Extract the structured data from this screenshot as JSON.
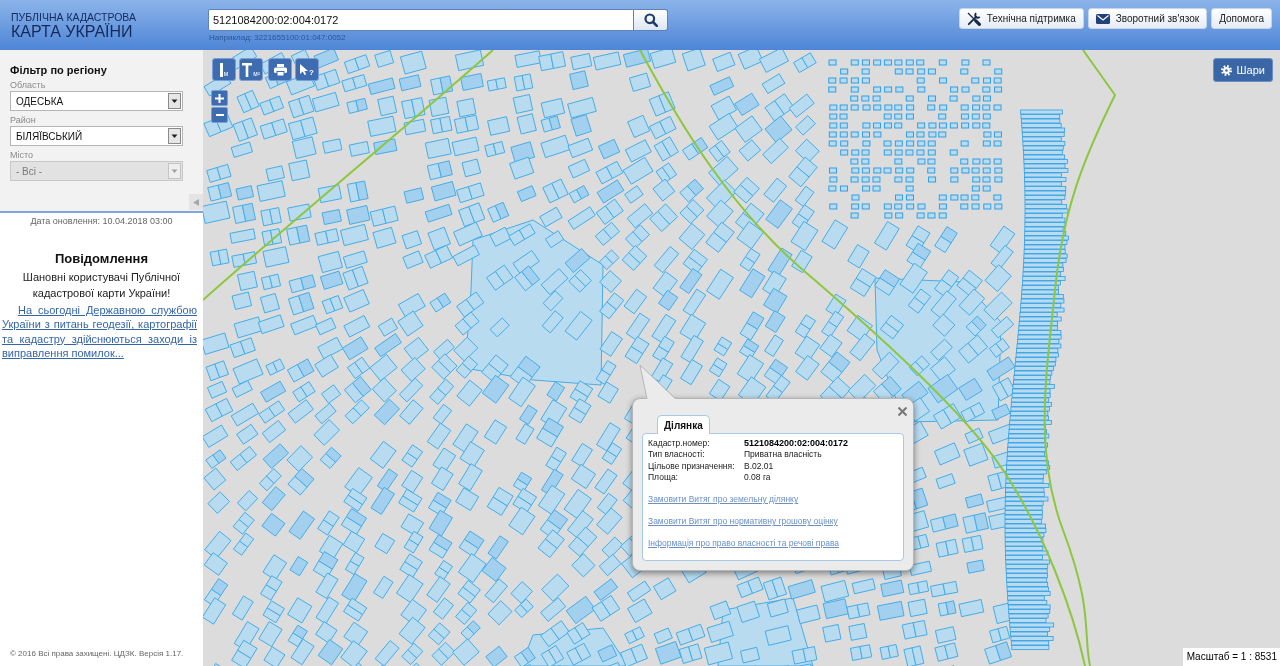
{
  "header": {
    "logo": {
      "line_1": "ПУБЛІЧНА КАДАСТРОВА",
      "line_2": "КАРТА УКРАЇНИ"
    },
    "search": {
      "value": "5121084200:02:004:0172",
      "example": "Наприклад: 3221655100:01:047:0052"
    },
    "buttons": [
      {
        "kind": "support",
        "label": "Технічна підтримка"
      },
      {
        "kind": "feedback",
        "label": "Зворотний зв'язок"
      },
      {
        "kind": "help",
        "label": "Допомога"
      }
    ]
  },
  "sidebar": {
    "filter": {
      "title": "Фільтр по регіону",
      "fields": [
        {
          "label": "Область",
          "value": "ОДЕСЬКА",
          "disabled": false
        },
        {
          "label": "Район",
          "value": "БІЛЯЇВСЬКИЙ",
          "disabled": false
        },
        {
          "label": "Місто",
          "value": "- Всі -",
          "disabled": true
        }
      ]
    },
    "update_date": "Дата оновлення: 10.04.2018 03:00",
    "notice": {
      "title": "Повідомлення",
      "greeting": "Шановні користувачі Публічної кадастрової карти України!",
      "link": "На сьогодні Державною службою України з питань геодезії, картографії та кадастру здійснюються заходи із виправлення помилок..."
    },
    "footer": "© 2016 Всі права захищені. ЦДЗК. Версія 1.17."
  },
  "map": {
    "tools": [
      {
        "kind": "length",
        "label": "м"
      },
      {
        "kind": "area",
        "label": "м²"
      },
      {
        "kind": "print"
      },
      {
        "kind": "identify",
        "label": "?"
      }
    ],
    "layers_button": "Шари",
    "popup": {
      "tabs": [
        {
          "label": "Ділянка",
          "selected": true
        }
      ],
      "rows": [
        {
          "label": "Кадастр.номер:",
          "value": "5121084200:02:004:0172"
        },
        {
          "label": "Тип власності:",
          "value": "Приватна власність"
        },
        {
          "label": "Цільове призначення:",
          "value": "В.02.01"
        },
        {
          "label": "Площа:",
          "value": "0.08 га"
        }
      ],
      "links": [
        "Замовити Витяг про земельну ділянку",
        "Замовити Витяг про нормативну грошову оцінку",
        "Інформація про право власності та речові права"
      ]
    },
    "scale": "Масштаб = 1 : 8531"
  }
}
